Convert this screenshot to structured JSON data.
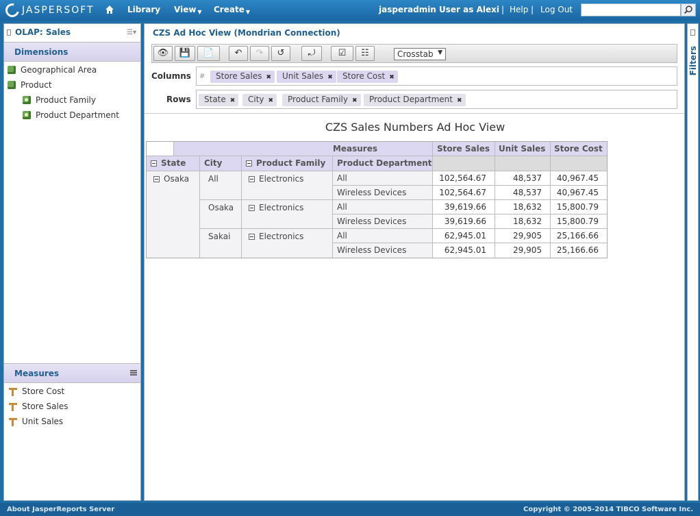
{
  "header": {
    "logo_text": "JASPERSOFT",
    "nav": {
      "library": "Library",
      "view": "View",
      "create": "Create"
    },
    "user_label": "jasperadmin User as Alexi",
    "help": "Help",
    "logout": "Log Out",
    "search_value": ""
  },
  "left_panel": {
    "title": "OLAP: Sales",
    "dimensions_header": "Dimensions",
    "dimensions": [
      "Geographical Area",
      "Product",
      "Product Family",
      "Product Department"
    ],
    "measures_header": "Measures",
    "measures": [
      "Store Cost",
      "Store Sales",
      "Unit Sales"
    ]
  },
  "main": {
    "title": "CZS Ad Hoc View (Mondrian Connection)",
    "view_mode": "Crosstab",
    "columns_label": "Columns",
    "rows_label": "Rows",
    "columns_hash": "#",
    "column_pills": [
      "Store Sales",
      "Unit Sales",
      "Store Cost"
    ],
    "row_pills": [
      "State",
      "City",
      "Product Family",
      "Product Department"
    ],
    "report_title": "CZS Sales Numbers Ad Hoc View"
  },
  "crosstab": {
    "measures_label": "Measures",
    "measure_headers": [
      "Store Sales",
      "Unit Sales",
      "Store Cost"
    ],
    "row_headers": [
      "State",
      "City",
      "Product Family",
      "Product Department"
    ],
    "state": "Osaka",
    "groups": [
      {
        "city": "All",
        "family": "Electronics",
        "rows": [
          {
            "dept": "All",
            "store_sales": "102,564.67",
            "unit_sales": "48,537",
            "store_cost": "40,967.45"
          },
          {
            "dept": "Wireless Devices",
            "store_sales": "102,564.67",
            "unit_sales": "48,537",
            "store_cost": "40,967.45"
          }
        ]
      },
      {
        "city": "Osaka",
        "family": "Electronics",
        "rows": [
          {
            "dept": "All",
            "store_sales": "39,619.66",
            "unit_sales": "18,632",
            "store_cost": "15,800.79"
          },
          {
            "dept": "Wireless Devices",
            "store_sales": "39,619.66",
            "unit_sales": "18,632",
            "store_cost": "15,800.79"
          }
        ]
      },
      {
        "city": "Sakai",
        "family": "Electronics",
        "rows": [
          {
            "dept": "All",
            "store_sales": "62,945.01",
            "unit_sales": "29,905",
            "store_cost": "25,166.66"
          },
          {
            "dept": "Wireless Devices",
            "store_sales": "62,945.01",
            "unit_sales": "29,905",
            "store_cost": "25,166.66"
          }
        ]
      }
    ]
  },
  "filters_label": "Filters",
  "footer": {
    "left": "About JasperReports Server",
    "right": "Copyright © 2005-2014 TIBCO Software Inc."
  }
}
